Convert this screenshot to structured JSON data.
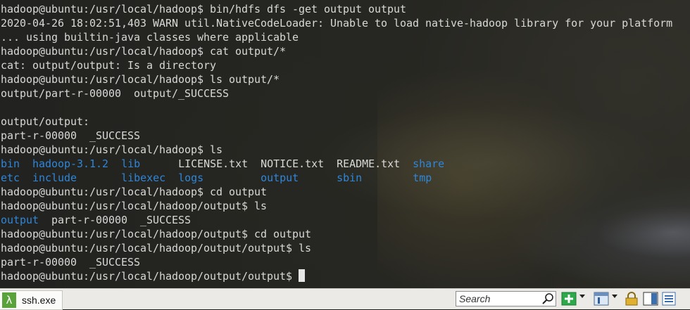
{
  "terminal": {
    "lines": [
      [
        {
          "t": "hadoop@ubuntu:/usr/local/hadoop$ bin/hdfs dfs -get output output"
        }
      ],
      [
        {
          "t": "2020-04-26 18:02:51,403 WARN util.NativeCodeLoader: Unable to load native-hadoop library for your platform"
        }
      ],
      [
        {
          "t": "... using builtin-java classes where applicable"
        }
      ],
      [
        {
          "t": "hadoop@ubuntu:/usr/local/hadoop$ cat output/*"
        }
      ],
      [
        {
          "t": "cat: output/output: Is a directory"
        }
      ],
      [
        {
          "t": "hadoop@ubuntu:/usr/local/hadoop$ ls output/*"
        }
      ],
      [
        {
          "t": "output/part-r-00000  output/_SUCCESS"
        }
      ],
      [
        {
          "t": ""
        }
      ],
      [
        {
          "t": "output/output:"
        }
      ],
      [
        {
          "t": "part-r-00000  _SUCCESS"
        }
      ],
      [
        {
          "t": "hadoop@ubuntu:/usr/local/hadoop$ ls"
        }
      ],
      [
        {
          "t": "bin",
          "c": "b"
        },
        {
          "t": "  "
        },
        {
          "t": "hadoop-3.1.2",
          "c": "b"
        },
        {
          "t": "  "
        },
        {
          "t": "lib",
          "c": "b"
        },
        {
          "t": "      LICENSE.txt  NOTICE.txt  README.txt  "
        },
        {
          "t": "share",
          "c": "b"
        }
      ],
      [
        {
          "t": "etc",
          "c": "b"
        },
        {
          "t": "  "
        },
        {
          "t": "include",
          "c": "b"
        },
        {
          "t": "       "
        },
        {
          "t": "libexec",
          "c": "b"
        },
        {
          "t": "  "
        },
        {
          "t": "logs",
          "c": "b"
        },
        {
          "t": "         "
        },
        {
          "t": "output",
          "c": "b"
        },
        {
          "t": "      "
        },
        {
          "t": "sbin",
          "c": "b"
        },
        {
          "t": "        "
        },
        {
          "t": "tmp",
          "c": "b"
        }
      ],
      [
        {
          "t": "hadoop@ubuntu:/usr/local/hadoop$ cd output"
        }
      ],
      [
        {
          "t": "hadoop@ubuntu:/usr/local/hadoop/output$ ls"
        }
      ],
      [
        {
          "t": "output",
          "c": "b"
        },
        {
          "t": "  part-r-00000  _SUCCESS"
        }
      ],
      [
        {
          "t": "hadoop@ubuntu:/usr/local/hadoop/output$ cd output"
        }
      ],
      [
        {
          "t": "hadoop@ubuntu:/usr/local/hadoop/output/output$ ls"
        }
      ],
      [
        {
          "t": "part-r-00000  _SUCCESS"
        }
      ],
      [
        {
          "t": "hadoop@ubuntu:/usr/local/hadoop/output/output$ "
        },
        {
          "t": "",
          "c": "cursor"
        }
      ]
    ]
  },
  "taskbar": {
    "app_label": "ssh.exe",
    "app_icon": "lambda-icon",
    "app_glyph": "λ",
    "search_placeholder": "Search",
    "icons": [
      "search-icon",
      "new-console-icon",
      "chevron-down-icon",
      "layout-icon",
      "chevron-down-icon",
      "lock-icon",
      "split-view-icon",
      "menu-icon"
    ]
  },
  "colors": {
    "text": "#d8d8d6",
    "directory": "#2f86d8",
    "lambda_green": "#5aa23a",
    "add_green": "#2da84a"
  }
}
